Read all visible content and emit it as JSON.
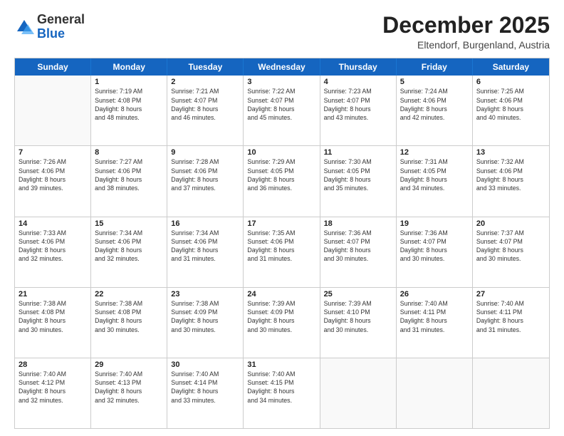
{
  "logo": {
    "general": "General",
    "blue": "Blue"
  },
  "header": {
    "month": "December 2025",
    "location": "Eltendorf, Burgenland, Austria"
  },
  "weekdays": [
    "Sunday",
    "Monday",
    "Tuesday",
    "Wednesday",
    "Thursday",
    "Friday",
    "Saturday"
  ],
  "rows": [
    [
      {
        "day": "",
        "info": ""
      },
      {
        "day": "1",
        "info": "Sunrise: 7:19 AM\nSunset: 4:08 PM\nDaylight: 8 hours\nand 48 minutes."
      },
      {
        "day": "2",
        "info": "Sunrise: 7:21 AM\nSunset: 4:07 PM\nDaylight: 8 hours\nand 46 minutes."
      },
      {
        "day": "3",
        "info": "Sunrise: 7:22 AM\nSunset: 4:07 PM\nDaylight: 8 hours\nand 45 minutes."
      },
      {
        "day": "4",
        "info": "Sunrise: 7:23 AM\nSunset: 4:07 PM\nDaylight: 8 hours\nand 43 minutes."
      },
      {
        "day": "5",
        "info": "Sunrise: 7:24 AM\nSunset: 4:06 PM\nDaylight: 8 hours\nand 42 minutes."
      },
      {
        "day": "6",
        "info": "Sunrise: 7:25 AM\nSunset: 4:06 PM\nDaylight: 8 hours\nand 40 minutes."
      }
    ],
    [
      {
        "day": "7",
        "info": "Sunrise: 7:26 AM\nSunset: 4:06 PM\nDaylight: 8 hours\nand 39 minutes."
      },
      {
        "day": "8",
        "info": "Sunrise: 7:27 AM\nSunset: 4:06 PM\nDaylight: 8 hours\nand 38 minutes."
      },
      {
        "day": "9",
        "info": "Sunrise: 7:28 AM\nSunset: 4:06 PM\nDaylight: 8 hours\nand 37 minutes."
      },
      {
        "day": "10",
        "info": "Sunrise: 7:29 AM\nSunset: 4:05 PM\nDaylight: 8 hours\nand 36 minutes."
      },
      {
        "day": "11",
        "info": "Sunrise: 7:30 AM\nSunset: 4:05 PM\nDaylight: 8 hours\nand 35 minutes."
      },
      {
        "day": "12",
        "info": "Sunrise: 7:31 AM\nSunset: 4:05 PM\nDaylight: 8 hours\nand 34 minutes."
      },
      {
        "day": "13",
        "info": "Sunrise: 7:32 AM\nSunset: 4:06 PM\nDaylight: 8 hours\nand 33 minutes."
      }
    ],
    [
      {
        "day": "14",
        "info": "Sunrise: 7:33 AM\nSunset: 4:06 PM\nDaylight: 8 hours\nand 32 minutes."
      },
      {
        "day": "15",
        "info": "Sunrise: 7:34 AM\nSunset: 4:06 PM\nDaylight: 8 hours\nand 32 minutes."
      },
      {
        "day": "16",
        "info": "Sunrise: 7:34 AM\nSunset: 4:06 PM\nDaylight: 8 hours\nand 31 minutes."
      },
      {
        "day": "17",
        "info": "Sunrise: 7:35 AM\nSunset: 4:06 PM\nDaylight: 8 hours\nand 31 minutes."
      },
      {
        "day": "18",
        "info": "Sunrise: 7:36 AM\nSunset: 4:07 PM\nDaylight: 8 hours\nand 30 minutes."
      },
      {
        "day": "19",
        "info": "Sunrise: 7:36 AM\nSunset: 4:07 PM\nDaylight: 8 hours\nand 30 minutes."
      },
      {
        "day": "20",
        "info": "Sunrise: 7:37 AM\nSunset: 4:07 PM\nDaylight: 8 hours\nand 30 minutes."
      }
    ],
    [
      {
        "day": "21",
        "info": "Sunrise: 7:38 AM\nSunset: 4:08 PM\nDaylight: 8 hours\nand 30 minutes."
      },
      {
        "day": "22",
        "info": "Sunrise: 7:38 AM\nSunset: 4:08 PM\nDaylight: 8 hours\nand 30 minutes."
      },
      {
        "day": "23",
        "info": "Sunrise: 7:38 AM\nSunset: 4:09 PM\nDaylight: 8 hours\nand 30 minutes."
      },
      {
        "day": "24",
        "info": "Sunrise: 7:39 AM\nSunset: 4:09 PM\nDaylight: 8 hours\nand 30 minutes."
      },
      {
        "day": "25",
        "info": "Sunrise: 7:39 AM\nSunset: 4:10 PM\nDaylight: 8 hours\nand 30 minutes."
      },
      {
        "day": "26",
        "info": "Sunrise: 7:40 AM\nSunset: 4:11 PM\nDaylight: 8 hours\nand 31 minutes."
      },
      {
        "day": "27",
        "info": "Sunrise: 7:40 AM\nSunset: 4:11 PM\nDaylight: 8 hours\nand 31 minutes."
      }
    ],
    [
      {
        "day": "28",
        "info": "Sunrise: 7:40 AM\nSunset: 4:12 PM\nDaylight: 8 hours\nand 32 minutes."
      },
      {
        "day": "29",
        "info": "Sunrise: 7:40 AM\nSunset: 4:13 PM\nDaylight: 8 hours\nand 32 minutes."
      },
      {
        "day": "30",
        "info": "Sunrise: 7:40 AM\nSunset: 4:14 PM\nDaylight: 8 hours\nand 33 minutes."
      },
      {
        "day": "31",
        "info": "Sunrise: 7:40 AM\nSunset: 4:15 PM\nDaylight: 8 hours\nand 34 minutes."
      },
      {
        "day": "",
        "info": ""
      },
      {
        "day": "",
        "info": ""
      },
      {
        "day": "",
        "info": ""
      }
    ]
  ]
}
